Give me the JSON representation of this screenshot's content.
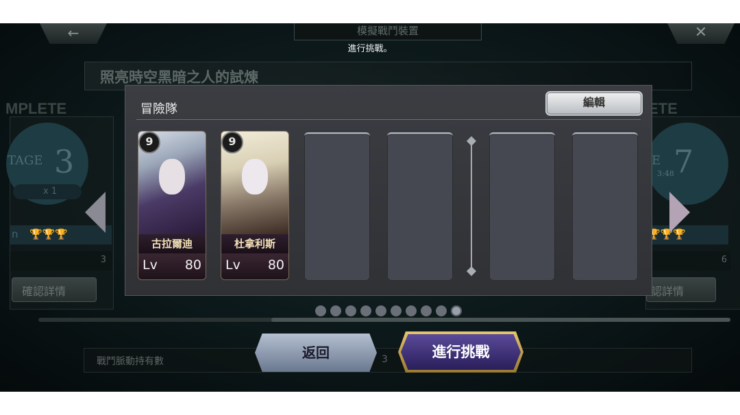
{
  "header": {
    "back_icon": "←",
    "close_icon": "✕",
    "title": "模擬戰鬥裝置",
    "subtitle": "進行挑戰。"
  },
  "trial_title": "照亮時空黑暗之人的試煉",
  "background_cards": {
    "left": {
      "complete": "MPLETE",
      "stage": "TAGE",
      "number": "3",
      "multiplier": "x 1",
      "trophy_label": "n",
      "count": "3",
      "confirm": "確認詳情"
    },
    "right": {
      "complete": "ETE",
      "stage": "E",
      "number": "7",
      "time": "3:48",
      "count": "6",
      "confirm": "認詳情"
    }
  },
  "pagination": {
    "total": 10,
    "active_index": 9
  },
  "bottom_bar": {
    "label": "戰鬥脈動持有數",
    "value": "3"
  },
  "modal": {
    "title": "冒險隊",
    "edit_button": "編輯",
    "heroes": [
      {
        "name": "古拉爾迪",
        "level_label": "Lv",
        "level": "80",
        "rank": "9"
      },
      {
        "name": "杜拿利斯",
        "level_label": "Lv",
        "level": "80",
        "rank": "9"
      }
    ]
  },
  "buttons": {
    "back": "返回",
    "challenge": "進行挑戰"
  },
  "colors": {
    "modal_bg": "#3b3d42",
    "challenge_border": "#e4c670",
    "challenge_fill": "#3a2e7a",
    "name_text": "#f3e2b8"
  }
}
